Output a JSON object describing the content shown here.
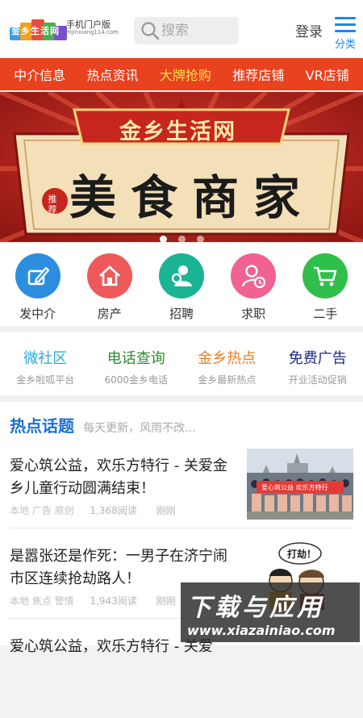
{
  "header": {
    "logo_brand": "金乡生活网",
    "logo_title": "手机门户版",
    "logo_domain": "mjinxiang114.com",
    "search_placeholder": "搜索",
    "login_label": "登录",
    "menu_label": "分类"
  },
  "nav": {
    "items": [
      {
        "label": "中介信息"
      },
      {
        "label": "热点资讯"
      },
      {
        "label": "大牌抢购"
      },
      {
        "label": "推荐店铺"
      },
      {
        "label": "VR店铺"
      }
    ]
  },
  "banner": {
    "site_name": "金乡生活网",
    "badge": "推荐",
    "headline": "美食商家",
    "slide_count": 3,
    "active_slide": 1,
    "colors": {
      "bg": "#b3221c",
      "panel": "#f3dfb8",
      "ink": "#1b1b1b"
    }
  },
  "categories": [
    {
      "label": "发中介",
      "icon": "edit-icon",
      "color": "#2d8ee0"
    },
    {
      "label": "房产",
      "icon": "house-icon",
      "color": "#ee5a5a"
    },
    {
      "label": "招聘",
      "icon": "recruit-icon",
      "color": "#1ab394"
    },
    {
      "label": "求职",
      "icon": "job-seek-icon",
      "color": "#f06292"
    },
    {
      "label": "二手",
      "icon": "cart-icon",
      "color": "#2fbf4a"
    }
  ],
  "services": [
    {
      "title": "微社区",
      "subtitle": "金乡啦呱平台",
      "color": "#2aa8d8"
    },
    {
      "title": "电话查询",
      "subtitle": "6000金乡电话",
      "color": "#2e8b2e"
    },
    {
      "title": "金乡热点",
      "subtitle": "金乡最新热点",
      "color": "#f07c1e"
    },
    {
      "title": "免费广告",
      "subtitle": "开业活动促销",
      "color": "#1a2a88"
    }
  ],
  "topics": {
    "title": "热点话题",
    "subtitle": "每天更新，风雨不改...",
    "articles": [
      {
        "title": "爱心筑公益，欢乐方特行 - 关爱金乡儿童行动圆满结束！",
        "tags": "本地 广告 原创",
        "reads": "1,368阅读",
        "time": "刚刚",
        "banner_text": "爱心筑公益 欢乐方特行"
      },
      {
        "title": "是嚣张还是作死：一男子在济宁闹市区连续抢劫路人！",
        "tags": "本地 焦点 警情",
        "reads": "1,943阅读",
        "time": "刚刚",
        "bubble_text": "打劫！"
      },
      {
        "title": "爱心筑公益，欢乐方特行 - 关爱"
      }
    ]
  },
  "watermark": {
    "line1": "下载与应用",
    "line2": "www.xiazainiao.com"
  }
}
